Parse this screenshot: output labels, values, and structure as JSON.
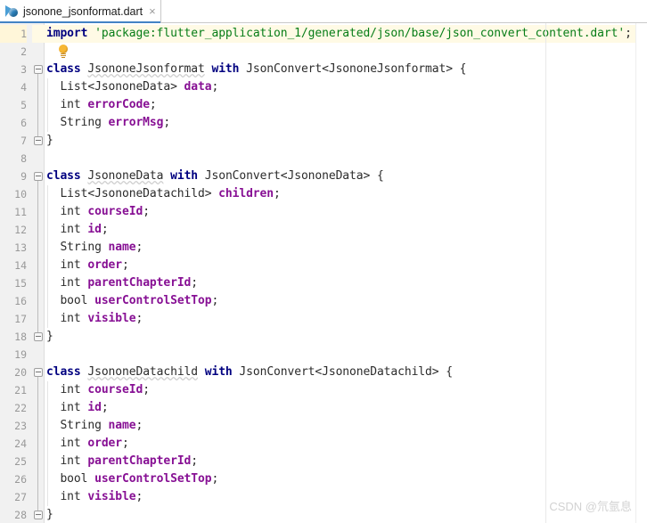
{
  "tab": {
    "label": "jsonone_jsonformat.dart",
    "icon": "dart-file-icon",
    "close_label": "×"
  },
  "editor": {
    "language": "dart",
    "current_line": 1,
    "total_lines": 28,
    "colors": {
      "keyword": "#000080",
      "field": "#871094",
      "string": "#067d17",
      "text": "#2b2b2b",
      "current_line_bg": "#fffae5",
      "gutter_bg": "#f1f1f1",
      "line_number": "#999999"
    },
    "line_numbers": [
      1,
      2,
      3,
      4,
      5,
      6,
      7,
      8,
      9,
      10,
      11,
      12,
      13,
      14,
      15,
      16,
      17,
      18,
      19,
      20,
      21,
      22,
      23,
      24,
      25,
      26,
      27,
      28
    ],
    "lines": [
      {
        "n": 1,
        "tokens": [
          {
            "t": "import",
            "c": "kw"
          },
          {
            "t": " ",
            "c": "pun"
          },
          {
            "t": "'package:flutter_application_1/generated/json/base/json_convert_content.dart'",
            "c": "str"
          },
          {
            "t": ";",
            "c": "pun"
          }
        ]
      },
      {
        "n": 2,
        "tokens": []
      },
      {
        "n": 3,
        "fold": "start",
        "tokens": [
          {
            "t": "class",
            "c": "kw"
          },
          {
            "t": " ",
            "c": "pun"
          },
          {
            "t": "JsononeJsonformat",
            "c": "cls"
          },
          {
            "t": " ",
            "c": "pun"
          },
          {
            "t": "with",
            "c": "kw"
          },
          {
            "t": " ",
            "c": "pun"
          },
          {
            "t": "JsonConvert<JsononeJsonformat>",
            "c": "typ"
          },
          {
            "t": " {",
            "c": "pun"
          }
        ]
      },
      {
        "n": 4,
        "tokens": [
          {
            "t": "  List<JsononeData> ",
            "c": "typ"
          },
          {
            "t": "data",
            "c": "fld"
          },
          {
            "t": ";",
            "c": "pun"
          }
        ]
      },
      {
        "n": 5,
        "tokens": [
          {
            "t": "  int ",
            "c": "typ"
          },
          {
            "t": "errorCode",
            "c": "fld"
          },
          {
            "t": ";",
            "c": "pun"
          }
        ]
      },
      {
        "n": 6,
        "tokens": [
          {
            "t": "  String ",
            "c": "typ"
          },
          {
            "t": "errorMsg",
            "c": "fld"
          },
          {
            "t": ";",
            "c": "pun"
          }
        ]
      },
      {
        "n": 7,
        "fold": "end",
        "tokens": [
          {
            "t": "}",
            "c": "pun"
          }
        ]
      },
      {
        "n": 8,
        "tokens": []
      },
      {
        "n": 9,
        "fold": "start",
        "tokens": [
          {
            "t": "class",
            "c": "kw"
          },
          {
            "t": " ",
            "c": "pun"
          },
          {
            "t": "JsononeData",
            "c": "cls"
          },
          {
            "t": " ",
            "c": "pun"
          },
          {
            "t": "with",
            "c": "kw"
          },
          {
            "t": " ",
            "c": "pun"
          },
          {
            "t": "JsonConvert<JsononeData>",
            "c": "typ"
          },
          {
            "t": " {",
            "c": "pun"
          }
        ]
      },
      {
        "n": 10,
        "tokens": [
          {
            "t": "  List<JsononeDatachild> ",
            "c": "typ"
          },
          {
            "t": "children",
            "c": "fld"
          },
          {
            "t": ";",
            "c": "pun"
          }
        ]
      },
      {
        "n": 11,
        "tokens": [
          {
            "t": "  int ",
            "c": "typ"
          },
          {
            "t": "courseId",
            "c": "fld"
          },
          {
            "t": ";",
            "c": "pun"
          }
        ]
      },
      {
        "n": 12,
        "tokens": [
          {
            "t": "  int ",
            "c": "typ"
          },
          {
            "t": "id",
            "c": "fld"
          },
          {
            "t": ";",
            "c": "pun"
          }
        ]
      },
      {
        "n": 13,
        "tokens": [
          {
            "t": "  String ",
            "c": "typ"
          },
          {
            "t": "name",
            "c": "fld"
          },
          {
            "t": ";",
            "c": "pun"
          }
        ]
      },
      {
        "n": 14,
        "tokens": [
          {
            "t": "  int ",
            "c": "typ"
          },
          {
            "t": "order",
            "c": "fld"
          },
          {
            "t": ";",
            "c": "pun"
          }
        ]
      },
      {
        "n": 15,
        "tokens": [
          {
            "t": "  int ",
            "c": "typ"
          },
          {
            "t": "parentChapterId",
            "c": "fld"
          },
          {
            "t": ";",
            "c": "pun"
          }
        ]
      },
      {
        "n": 16,
        "tokens": [
          {
            "t": "  bool ",
            "c": "typ"
          },
          {
            "t": "userControlSetTop",
            "c": "fld"
          },
          {
            "t": ";",
            "c": "pun"
          }
        ]
      },
      {
        "n": 17,
        "tokens": [
          {
            "t": "  int ",
            "c": "typ"
          },
          {
            "t": "visible",
            "c": "fld"
          },
          {
            "t": ";",
            "c": "pun"
          }
        ]
      },
      {
        "n": 18,
        "fold": "end",
        "tokens": [
          {
            "t": "}",
            "c": "pun"
          }
        ]
      },
      {
        "n": 19,
        "tokens": []
      },
      {
        "n": 20,
        "fold": "start",
        "tokens": [
          {
            "t": "class",
            "c": "kw"
          },
          {
            "t": " ",
            "c": "pun"
          },
          {
            "t": "JsononeDatachild",
            "c": "cls"
          },
          {
            "t": " ",
            "c": "pun"
          },
          {
            "t": "with",
            "c": "kw"
          },
          {
            "t": " ",
            "c": "pun"
          },
          {
            "t": "JsonConvert<JsononeDatachild>",
            "c": "typ"
          },
          {
            "t": " {",
            "c": "pun"
          }
        ]
      },
      {
        "n": 21,
        "tokens": [
          {
            "t": "  int ",
            "c": "typ"
          },
          {
            "t": "courseId",
            "c": "fld"
          },
          {
            "t": ";",
            "c": "pun"
          }
        ]
      },
      {
        "n": 22,
        "tokens": [
          {
            "t": "  int ",
            "c": "typ"
          },
          {
            "t": "id",
            "c": "fld"
          },
          {
            "t": ";",
            "c": "pun"
          }
        ]
      },
      {
        "n": 23,
        "tokens": [
          {
            "t": "  String ",
            "c": "typ"
          },
          {
            "t": "name",
            "c": "fld"
          },
          {
            "t": ";",
            "c": "pun"
          }
        ]
      },
      {
        "n": 24,
        "tokens": [
          {
            "t": "  int ",
            "c": "typ"
          },
          {
            "t": "order",
            "c": "fld"
          },
          {
            "t": ";",
            "c": "pun"
          }
        ]
      },
      {
        "n": 25,
        "tokens": [
          {
            "t": "  int ",
            "c": "typ"
          },
          {
            "t": "parentChapterId",
            "c": "fld"
          },
          {
            "t": ";",
            "c": "pun"
          }
        ]
      },
      {
        "n": 26,
        "tokens": [
          {
            "t": "  bool ",
            "c": "typ"
          },
          {
            "t": "userControlSetTop",
            "c": "fld"
          },
          {
            "t": ";",
            "c": "pun"
          }
        ]
      },
      {
        "n": 27,
        "tokens": [
          {
            "t": "  int ",
            "c": "typ"
          },
          {
            "t": "visible",
            "c": "fld"
          },
          {
            "t": ";",
            "c": "pun"
          }
        ]
      },
      {
        "n": 28,
        "fold": "end",
        "tokens": [
          {
            "t": "}",
            "c": "pun"
          }
        ]
      }
    ],
    "intention_bulb": {
      "line": 2,
      "icon": "lightbulb-icon"
    }
  },
  "watermark": {
    "text": "CSDN @氘氩息"
  }
}
